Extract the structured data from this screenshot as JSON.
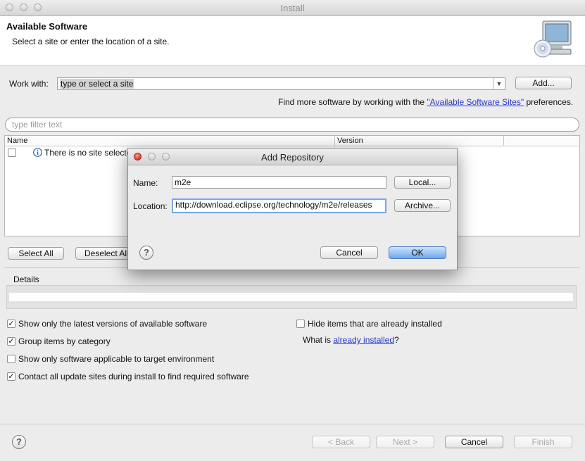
{
  "window": {
    "title": "Install"
  },
  "header": {
    "title": "Available Software",
    "subtitle": "Select a site or enter the location of a site."
  },
  "work_with": {
    "label": "Work with:",
    "value": "type or select a site",
    "add_button": "Add..."
  },
  "find_more": {
    "prefix": "Find more software by working with the ",
    "link": "\"Available Software Sites\"",
    "suffix": " preferences."
  },
  "filter": {
    "placeholder": "type filter text"
  },
  "table": {
    "columns": [
      "Name",
      "Version"
    ],
    "rows": [
      {
        "checked": false,
        "text": "There is no site selecte"
      }
    ]
  },
  "selection_buttons": {
    "select_all": "Select All",
    "deselect_all": "Deselect All"
  },
  "details": {
    "label": "Details"
  },
  "options": {
    "latest_versions": {
      "label": "Show only the latest versions of available software",
      "checked": true
    },
    "group_items": {
      "label": "Group items by category",
      "checked": true
    },
    "applicable_only": {
      "label": "Show only software applicable to target environment",
      "checked": false
    },
    "contact_sites": {
      "label": "Contact all update sites during install to find required software",
      "checked": true
    },
    "hide_installed": {
      "label": "Hide items that are already installed",
      "checked": false
    },
    "what_is": {
      "prefix": "What is ",
      "link": "already installed",
      "suffix": "?"
    }
  },
  "footer": {
    "back": "< Back",
    "next": "Next >",
    "cancel": "Cancel",
    "finish": "Finish"
  },
  "dialog": {
    "title": "Add Repository",
    "name_label": "Name:",
    "name_value": "m2e",
    "location_label": "Location:",
    "location_value": "http://download.eclipse.org/technology/m2e/releases",
    "local_button": "Local...",
    "archive_button": "Archive...",
    "cancel": "Cancel",
    "ok": "OK"
  },
  "colors": {
    "link": "#2437c7",
    "close_button": "#e0443e",
    "ok_button": "#6fa7ea"
  }
}
